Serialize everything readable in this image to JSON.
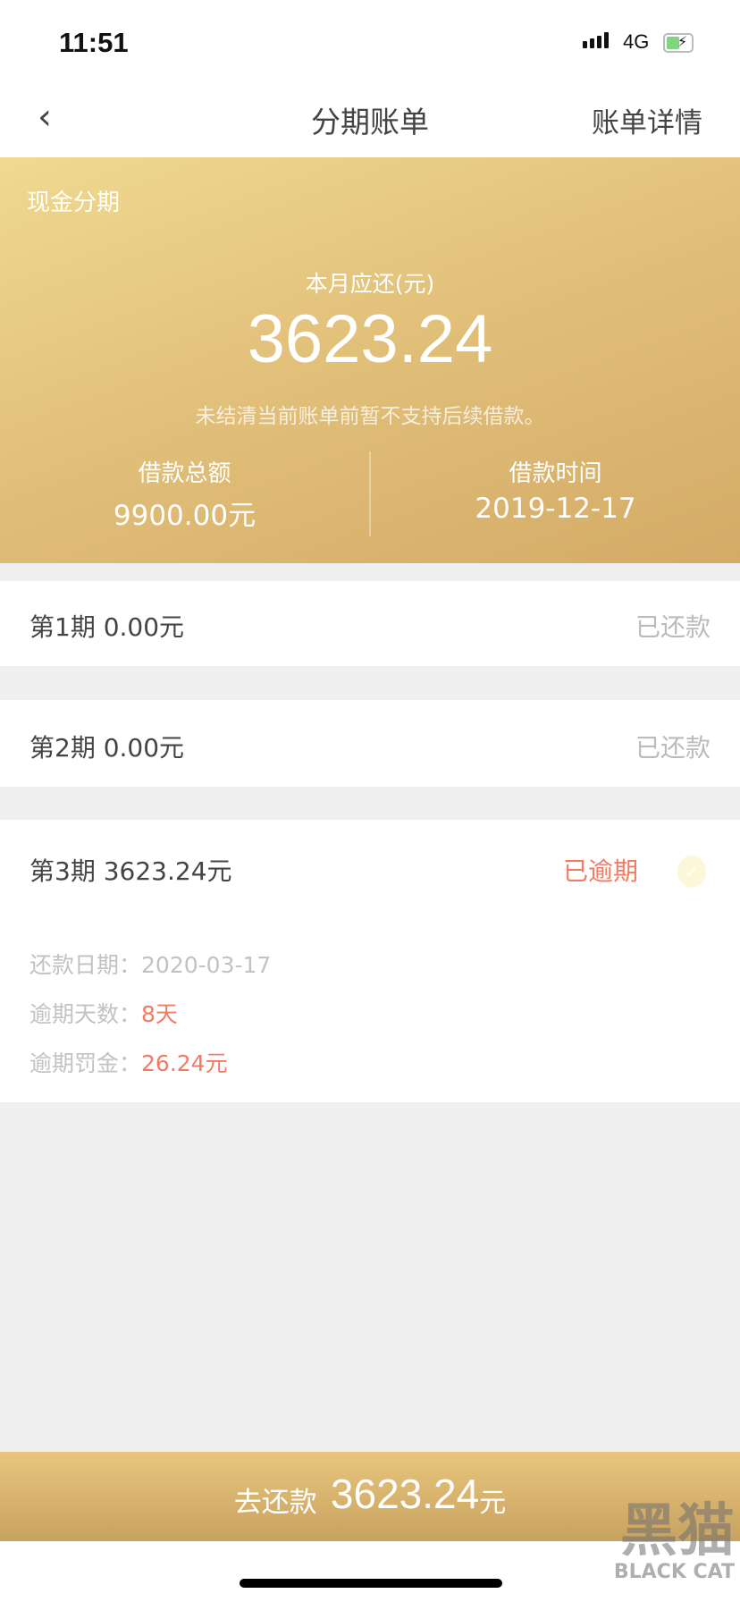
{
  "status_bar": {
    "time": "11:51",
    "network": "4G",
    "battery_charging": true
  },
  "nav": {
    "title": "分期账单",
    "right_action": "账单详情",
    "back_icon": "chevron-left-icon"
  },
  "summary": {
    "type_label": "现金分期",
    "due_label": "本月应还(元)",
    "due_amount": "3623.24",
    "notice": "未结清当前账单前暂不支持后续借款。",
    "loan_total_label": "借款总额",
    "loan_total_value": "9900.00元",
    "loan_date_label": "借款时间",
    "loan_date_value": "2019-12-17"
  },
  "installments": [
    {
      "label": "第1期  0.00元",
      "status": "已还款"
    },
    {
      "label": "第2期  0.00元",
      "status": "已还款"
    },
    {
      "label": "第3期  3623.24元",
      "status": "已逾期",
      "details": [
        {
          "label": "还款日期：",
          "value": "2020-03-17"
        },
        {
          "label": "逾期天数：",
          "value": "8天"
        },
        {
          "label": "逾期罚金：",
          "value": "26.24元"
        }
      ]
    }
  ],
  "pay_button": {
    "label": "去还款",
    "amount": "3623.24",
    "unit": "元"
  },
  "watermark": {
    "text": "黑猫",
    "sub": "BLACK CAT"
  },
  "colors": {
    "gold": "#d9b46c",
    "overdue": "#f27b64",
    "paid": "#bbbbbb"
  }
}
